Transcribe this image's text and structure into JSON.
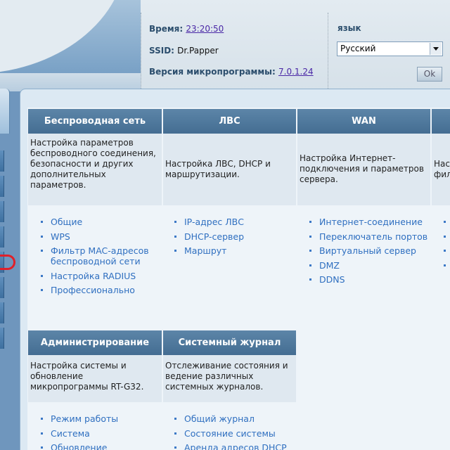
{
  "header": {
    "time_label": "Время:",
    "time_value": "23:20:50",
    "ssid_label": "SSID:",
    "ssid_value": "Dr.Papper",
    "firmware_label": "Версия микропрограммы:",
    "firmware_value": "7.0.1.24",
    "language_label": "язык",
    "language_selected": "Русский",
    "ok_label": "Ok"
  },
  "icons": [
    "chevron-down-icon",
    "bullet-icon"
  ],
  "colors": {
    "section_header": "#4f789c",
    "link": "#2f6fc0",
    "highlight_mark": "#e0202a"
  },
  "sections": [
    {
      "title": "Беспроводная сеть",
      "description": "Настройка параметров беспроводного соединения, безопасности и других дополнительных параметров.",
      "links": [
        "Общие",
        "WPS",
        "Фильтр MAC-адресов беспроводной сети",
        "Настройка RADIUS",
        "Профессионально"
      ]
    },
    {
      "title": "ЛВС",
      "description": "Настройка ЛВС, DHCP и маршрутизации.",
      "links": [
        "IP-адрес ЛВС",
        "DHCP-сервер",
        "Маршрут"
      ]
    },
    {
      "title": "WAN",
      "description": "Настройка Интернет-подключения и параметров сервера.",
      "links": [
        "Интернет-соединение",
        "Переключатель портов",
        "Виртуальный сервер",
        "DMZ",
        "DDNS"
      ]
    },
    {
      "title": "Администрирование",
      "description": "Настройка системы и обновление микропрограммы RT-G32.",
      "links": [
        "Режим работы",
        "Система",
        "Обновление"
      ]
    },
    {
      "title": "Системный журнал",
      "description": "Отслеживание состояния и ведение различных системных журналов.",
      "links": [
        "Общий журнал",
        "Состояние системы",
        "Аренда адресов DHCP"
      ]
    },
    {
      "title": "",
      "description": "Нас\nфил",
      "links": [
        "",
        "",
        "",
        ""
      ]
    }
  ]
}
